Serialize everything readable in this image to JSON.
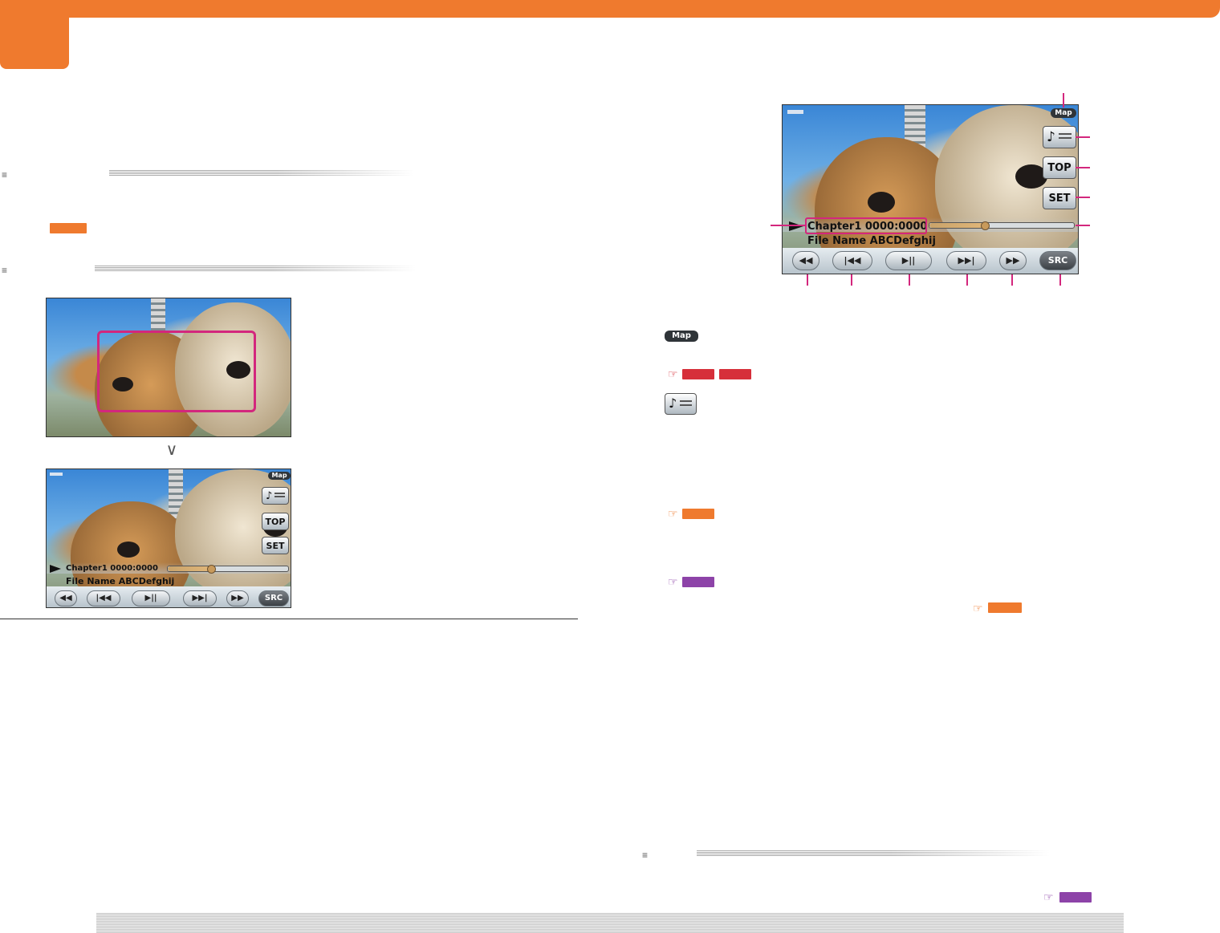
{
  "colors": {
    "accent_orange": "#ef7a2e",
    "ref_red": "#d62f3a",
    "ref_purple": "#8d43a8",
    "callout_magenta": "#d3277d"
  },
  "section_marks": {
    "mark_1": "≡",
    "mark_2": "≡",
    "mark_3": "≡"
  },
  "arrow_down": "∨",
  "ref_hand": "☞",
  "small_screen": {
    "map_label": "Map",
    "top_label": "TOP",
    "set_label": "SET",
    "chapter_text": "Chapter1  0000:0000",
    "file_name": "File Name ABCDefghij",
    "src_label": "SRC",
    "progress": 0.35
  },
  "main_screen": {
    "map_label": "Map",
    "top_label": "TOP",
    "set_label": "SET",
    "chapter_text": "Chapter1  0000:0000",
    "file_name": "File Name ABCDefghij",
    "src_label": "SRC",
    "progress": 0.38
  },
  "legend_icons": {
    "map_label": "Map"
  },
  "icons": {
    "rewind": "rewind-icon",
    "prev": "skip-previous-icon",
    "play_pause": "play-pause-icon",
    "next": "skip-next-icon",
    "fast_forward": "fast-forward-icon",
    "play_indicator": "play-indicator-icon",
    "music_list": "music-list-icon"
  }
}
